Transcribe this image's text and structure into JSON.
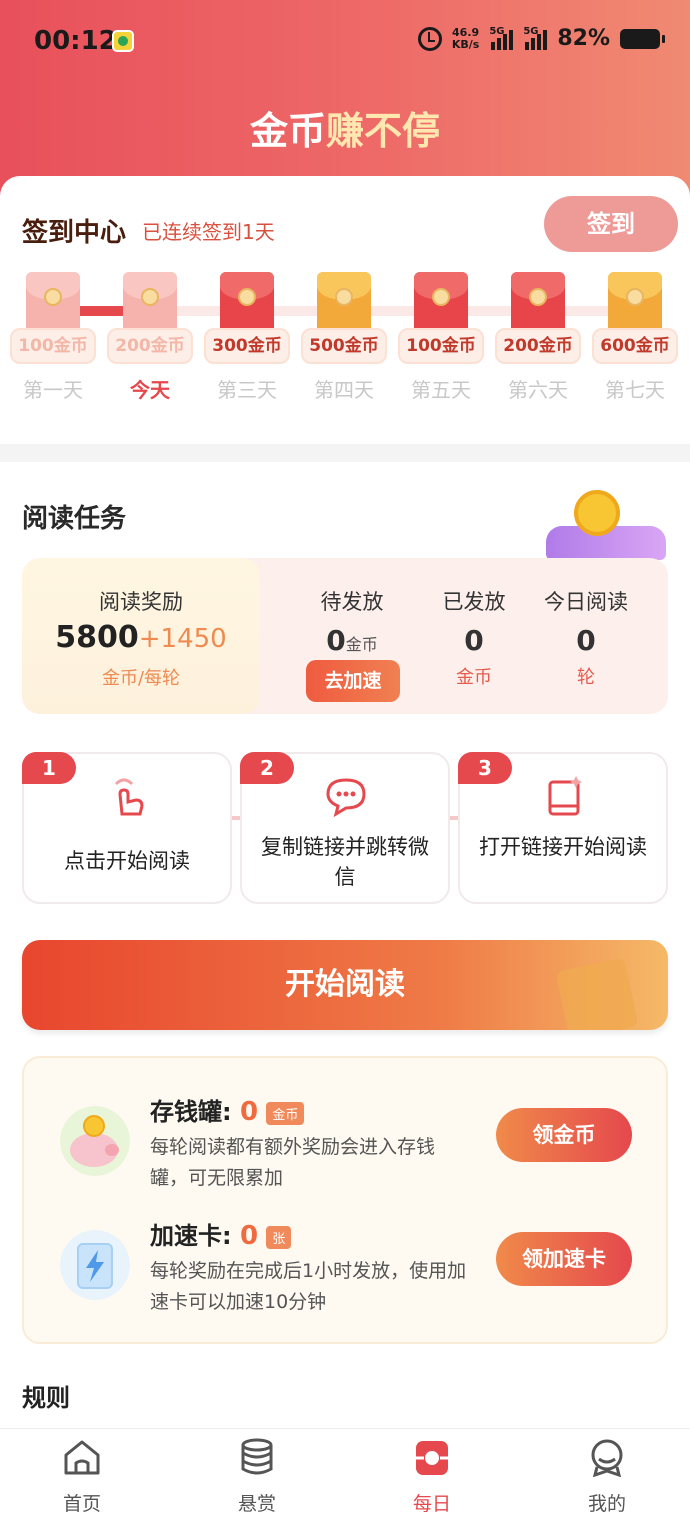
{
  "status_bar": {
    "time": "00:12",
    "net_speed": "46.9",
    "net_unit": "KB/s",
    "sig1": "5G",
    "sig2": "5G",
    "battery": "82%"
  },
  "header": {
    "title_a": "金币",
    "title_b": "赚不停"
  },
  "checkin": {
    "title": "签到中心",
    "streak_text": "已连续签到1天",
    "button": "签到",
    "days": [
      {
        "amount": "100金币",
        "label": "第一天",
        "state": "done"
      },
      {
        "amount": "200金币",
        "label": "今天",
        "state": "done"
      },
      {
        "amount": "300金币",
        "label": "第三天",
        "state": "red"
      },
      {
        "amount": "500金币",
        "label": "第四天",
        "state": "gold"
      },
      {
        "amount": "100金币",
        "label": "第五天",
        "state": "red"
      },
      {
        "amount": "200金币",
        "label": "第六天",
        "state": "red"
      },
      {
        "amount": "600金币",
        "label": "第七天",
        "state": "gold"
      }
    ]
  },
  "reading": {
    "title": "阅读任务",
    "reward": {
      "label": "阅读奖励",
      "value": "5800",
      "bonus": "+1450",
      "unit": "金币/每轮"
    },
    "pending": {
      "label": "待发放",
      "value": "0",
      "unit": "金币",
      "button": "去加速"
    },
    "issued": {
      "label": "已发放",
      "value": "0",
      "unit": "金币"
    },
    "today": {
      "label": "今日阅读",
      "value": "0",
      "unit": "轮"
    },
    "steps": [
      {
        "num": "1",
        "text": "点击开始阅读"
      },
      {
        "num": "2",
        "text": "复制链接并跳转微信"
      },
      {
        "num": "3",
        "text": "打开链接开始阅读"
      }
    ],
    "start_button": "开始阅读"
  },
  "perks": {
    "piggy": {
      "name": "存钱罐:",
      "count": "0",
      "tag": "金币",
      "desc": "每轮阅读都有额外奖励会进入存钱罐，可无限累加",
      "button": "领金币"
    },
    "speed": {
      "name": "加速卡:",
      "count": "0",
      "tag": "张",
      "desc": "每轮奖励在完成后1小时发放，使用加速卡可以加速10分钟",
      "button": "领加速卡"
    }
  },
  "rules_title": "规则",
  "nav": [
    {
      "label": "首页",
      "icon": "home-icon"
    },
    {
      "label": "悬赏",
      "icon": "coins-stack-icon"
    },
    {
      "label": "每日",
      "icon": "daily-icon"
    },
    {
      "label": "我的",
      "icon": "profile-icon"
    }
  ],
  "colors": {
    "brand_red": "#e5484d",
    "orange": "#ef8a51"
  }
}
